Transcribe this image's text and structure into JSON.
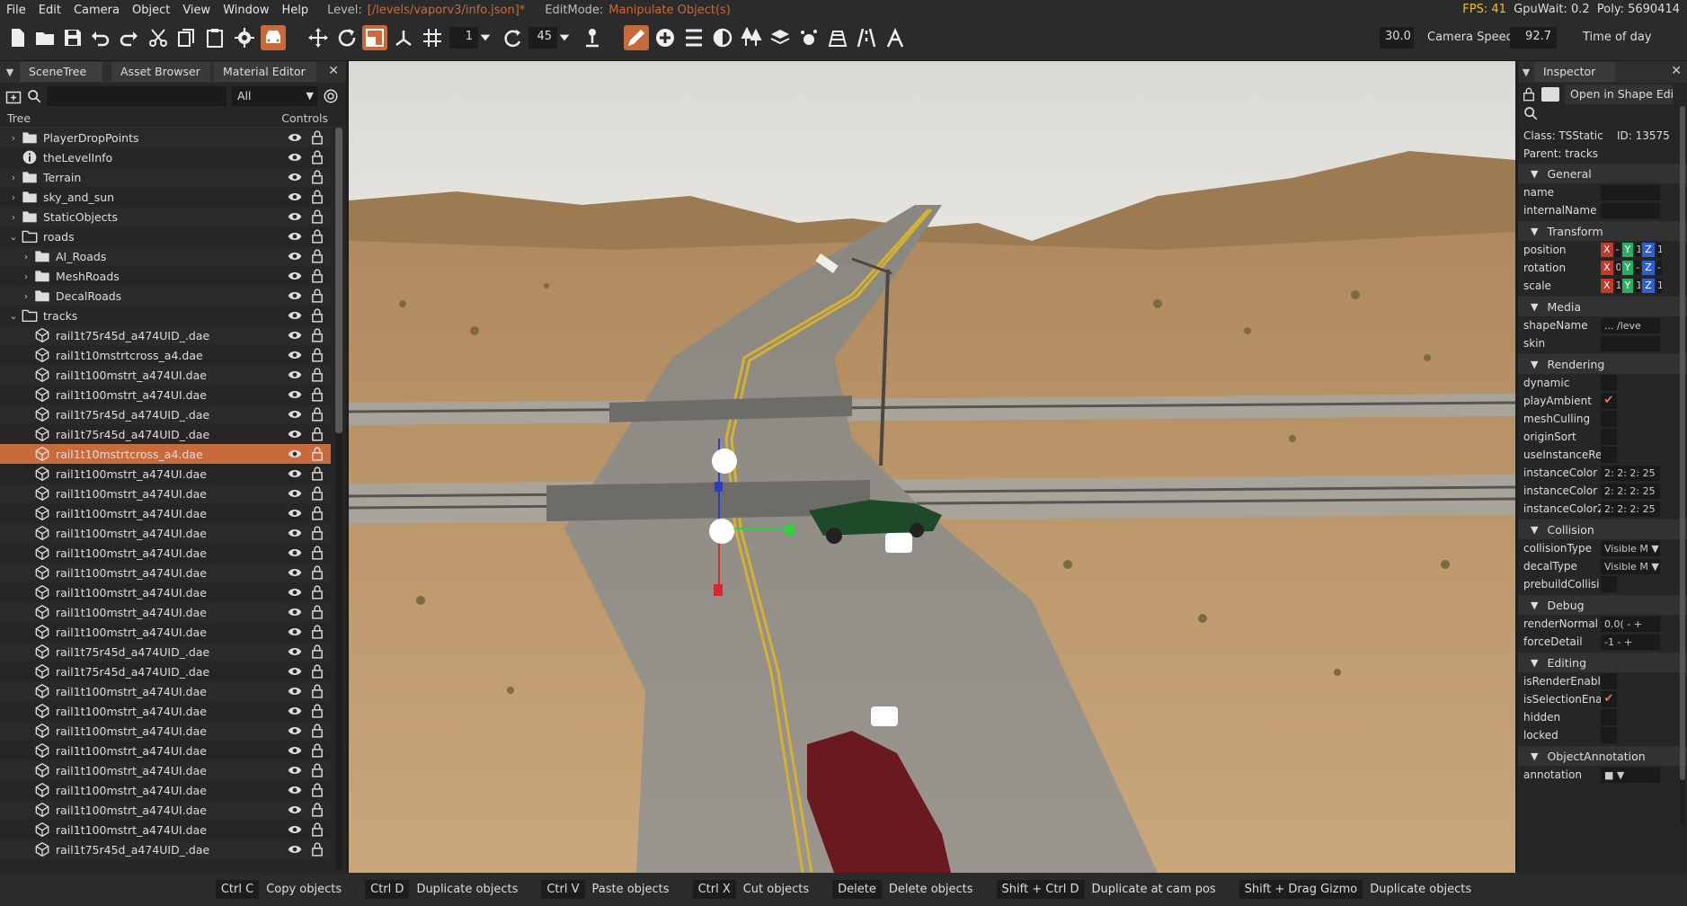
{
  "menu": {
    "items": [
      "File",
      "Edit",
      "Camera",
      "Object",
      "View",
      "Window",
      "Help"
    ],
    "level_label": "Level:",
    "level_path": "[/levels/vaporv3/info.json]*",
    "editmode_label": "EditMode:",
    "editmode_value": "Manipulate Object(s)",
    "fps": "FPS: 41",
    "gpuwait": "GpuWait: 0.2",
    "poly": "Poly: 5690414"
  },
  "toolbar": {
    "snap_value": "1",
    "rot_snap_value": "45",
    "speed_value": "30.0",
    "speed_label": "Camera Speed",
    "tod_value": "92.7",
    "tod_label": "Time of day"
  },
  "left_panel": {
    "tabs": [
      "SceneTree",
      "Asset Browser",
      "Material Editor"
    ],
    "filter": "All",
    "tree_header": "Tree",
    "controls_header": "Controls",
    "rows": [
      {
        "label": "PlayerDropPoints",
        "indent": 0,
        "arrow": "›",
        "icon": "folder"
      },
      {
        "label": "theLevelInfo",
        "indent": 0,
        "arrow": "",
        "icon": "info"
      },
      {
        "label": "Terrain",
        "indent": 0,
        "arrow": "›",
        "icon": "folder"
      },
      {
        "label": "sky_and_sun",
        "indent": 0,
        "arrow": "›",
        "icon": "folder"
      },
      {
        "label": "StaticObjects",
        "indent": 0,
        "arrow": "›",
        "icon": "folder"
      },
      {
        "label": "roads",
        "indent": 0,
        "arrow": "⌄",
        "icon": "folder-open"
      },
      {
        "label": "AI_Roads",
        "indent": 1,
        "arrow": "›",
        "icon": "folder"
      },
      {
        "label": "MeshRoads",
        "indent": 1,
        "arrow": "›",
        "icon": "folder"
      },
      {
        "label": "DecalRoads",
        "indent": 1,
        "arrow": "›",
        "icon": "folder"
      },
      {
        "label": "tracks",
        "indent": 0,
        "arrow": "⌄",
        "icon": "folder-open"
      },
      {
        "label": "rail1t75r45d_a474UID_.dae",
        "indent": 1,
        "arrow": "",
        "icon": "shape"
      },
      {
        "label": "rail1t10mstrtcross_a4.dae",
        "indent": 1,
        "arrow": "",
        "icon": "shape"
      },
      {
        "label": "rail1t100mstrt_a474UI.dae",
        "indent": 1,
        "arrow": "",
        "icon": "shape"
      },
      {
        "label": "rail1t100mstrt_a474UI.dae",
        "indent": 1,
        "arrow": "",
        "icon": "shape"
      },
      {
        "label": "rail1t75r45d_a474UID_.dae",
        "indent": 1,
        "arrow": "",
        "icon": "shape"
      },
      {
        "label": "rail1t75r45d_a474UID_.dae",
        "indent": 1,
        "arrow": "",
        "icon": "shape"
      },
      {
        "label": "rail1t10mstrtcross_a4.dae",
        "indent": 1,
        "arrow": "",
        "icon": "shape",
        "selected": true
      },
      {
        "label": "rail1t100mstrt_a474UI.dae",
        "indent": 1,
        "arrow": "",
        "icon": "shape"
      },
      {
        "label": "rail1t100mstrt_a474UI.dae",
        "indent": 1,
        "arrow": "",
        "icon": "shape"
      },
      {
        "label": "rail1t100mstrt_a474UI.dae",
        "indent": 1,
        "arrow": "",
        "icon": "shape"
      },
      {
        "label": "rail1t100mstrt_a474UI.dae",
        "indent": 1,
        "arrow": "",
        "icon": "shape"
      },
      {
        "label": "rail1t100mstrt_a474UI.dae",
        "indent": 1,
        "arrow": "",
        "icon": "shape"
      },
      {
        "label": "rail1t100mstrt_a474UI.dae",
        "indent": 1,
        "arrow": "",
        "icon": "shape"
      },
      {
        "label": "rail1t100mstrt_a474UI.dae",
        "indent": 1,
        "arrow": "",
        "icon": "shape"
      },
      {
        "label": "rail1t100mstrt_a474UI.dae",
        "indent": 1,
        "arrow": "",
        "icon": "shape"
      },
      {
        "label": "rail1t100mstrt_a474UI.dae",
        "indent": 1,
        "arrow": "",
        "icon": "shape"
      },
      {
        "label": "rail1t75r45d_a474UID_.dae",
        "indent": 1,
        "arrow": "",
        "icon": "shape"
      },
      {
        "label": "rail1t75r45d_a474UID_.dae",
        "indent": 1,
        "arrow": "",
        "icon": "shape"
      },
      {
        "label": "rail1t100mstrt_a474UI.dae",
        "indent": 1,
        "arrow": "",
        "icon": "shape"
      },
      {
        "label": "rail1t100mstrt_a474UI.dae",
        "indent": 1,
        "arrow": "",
        "icon": "shape"
      },
      {
        "label": "rail1t100mstrt_a474UI.dae",
        "indent": 1,
        "arrow": "",
        "icon": "shape"
      },
      {
        "label": "rail1t100mstrt_a474UI.dae",
        "indent": 1,
        "arrow": "",
        "icon": "shape"
      },
      {
        "label": "rail1t100mstrt_a474UI.dae",
        "indent": 1,
        "arrow": "",
        "icon": "shape"
      },
      {
        "label": "rail1t100mstrt_a474UI.dae",
        "indent": 1,
        "arrow": "",
        "icon": "shape"
      },
      {
        "label": "rail1t100mstrt_a474UI.dae",
        "indent": 1,
        "arrow": "",
        "icon": "shape"
      },
      {
        "label": "rail1t100mstrt_a474UI.dae",
        "indent": 1,
        "arrow": "",
        "icon": "shape"
      },
      {
        "label": "rail1t75r45d_a474UID_.dae",
        "indent": 1,
        "arrow": "",
        "icon": "shape"
      }
    ]
  },
  "inspector": {
    "tab": "Inspector",
    "open_shape_btn": "Open in Shape Edi",
    "class_line": "Class: TSStatic",
    "id_line": "ID: 13575",
    "parent_line": "Parent: tracks",
    "sections": [
      {
        "title": "General",
        "props": [
          {
            "name": "name",
            "type": "text",
            "value": ""
          },
          {
            "name": "internalName",
            "type": "text",
            "value": ""
          }
        ]
      },
      {
        "title": "Transform",
        "props": [
          {
            "name": "position",
            "type": "xyz",
            "x": "-",
            "y": "1",
            "z": "1"
          },
          {
            "name": "rotation",
            "type": "xyz",
            "x": "0",
            "y": "-",
            "z": "-"
          },
          {
            "name": "scale",
            "type": "xyz",
            "x": "1",
            "y": "1",
            "z": "1"
          }
        ]
      },
      {
        "title": "Media",
        "props": [
          {
            "name": "shapeName",
            "type": "text",
            "value": "...   /leve"
          },
          {
            "name": "skin",
            "type": "text",
            "value": ""
          }
        ]
      },
      {
        "title": "Rendering",
        "props": [
          {
            "name": "dynamic",
            "type": "check",
            "checked": false
          },
          {
            "name": "playAmbient",
            "type": "check",
            "checked": true
          },
          {
            "name": "meshCulling",
            "type": "check",
            "checked": false
          },
          {
            "name": "originSort",
            "type": "check",
            "checked": false
          },
          {
            "name": "useInstanceRe",
            "type": "check",
            "checked": false
          },
          {
            "name": "instanceColor",
            "type": "text",
            "value": "2: 2: 2: 25"
          },
          {
            "name": "instanceColor",
            "type": "text",
            "value": "2: 2: 2: 25"
          },
          {
            "name": "instanceColor2",
            "type": "text",
            "value": "2: 2: 2: 25"
          }
        ]
      },
      {
        "title": "Collision",
        "props": [
          {
            "name": "collisionType",
            "type": "text",
            "value": "Visible M ▼"
          },
          {
            "name": "decalType",
            "type": "text",
            "value": "Visible M ▼"
          },
          {
            "name": "prebuildCollisi",
            "type": "check",
            "checked": false
          }
        ]
      },
      {
        "title": "Debug",
        "props": [
          {
            "name": "renderNormal",
            "type": "text",
            "value": "0.0(  -   +"
          },
          {
            "name": "forceDetail",
            "type": "text",
            "value": "-1   -   +"
          }
        ]
      },
      {
        "title": "Editing",
        "props": [
          {
            "name": "isRenderEnabl",
            "type": "check",
            "checked": false
          },
          {
            "name": "isSelectionEna",
            "type": "check",
            "checked": true
          },
          {
            "name": "hidden",
            "type": "check",
            "checked": false
          },
          {
            "name": "locked",
            "type": "check",
            "checked": false
          }
        ]
      },
      {
        "title": "ObjectAnnotation",
        "props": [
          {
            "name": "annotation",
            "type": "text",
            "value": "■  ▼"
          }
        ]
      }
    ]
  },
  "status": [
    {
      "key": "Ctrl C",
      "desc": "Copy objects"
    },
    {
      "key": "Ctrl D",
      "desc": "Duplicate objects"
    },
    {
      "key": "Ctrl V",
      "desc": "Paste objects"
    },
    {
      "key": "Ctrl X",
      "desc": "Cut objects"
    },
    {
      "key": "Delete",
      "desc": "Delete objects"
    },
    {
      "key": "Shift + Ctrl D",
      "desc": "Duplicate at cam pos"
    },
    {
      "key": "Shift + Drag Gizmo",
      "desc": "Duplicate objects"
    }
  ]
}
